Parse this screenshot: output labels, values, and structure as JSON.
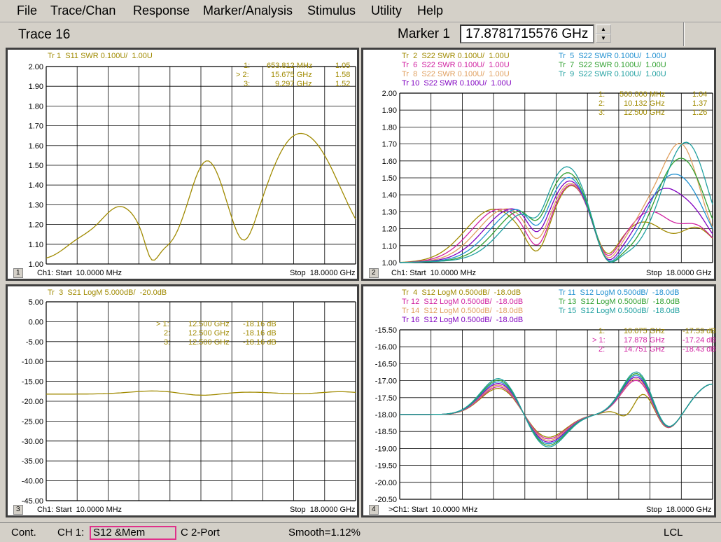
{
  "menu": [
    "File",
    "Trace/Chan",
    "Response",
    "Marker/Analysis",
    "Stimulus",
    "Utility",
    "Help"
  ],
  "header": {
    "trace_title": "Trace 16",
    "marker_label": "Marker 1",
    "marker_value": "17.8781715576 GHz"
  },
  "colors": {
    "olive": "#a08a00",
    "darkolive": "#7a6a10",
    "magenta": "#d020a0",
    "blue": "#2090d0",
    "green": "#30a030",
    "tan": "#e0a060",
    "purple": "#8000c0",
    "teal": "#20a0a0"
  },
  "panels": [
    {
      "id": 1,
      "legend": [
        {
          "text": "Tr 1  S11 SWR 0.100U/  1.00U",
          "color": "#a08a00"
        }
      ],
      "markers": [
        {
          "idx": "1:",
          "freq": "653.812 MHz",
          "val": "1.05"
        },
        {
          "idx": "> 2:",
          "freq": "15.675 GHz",
          "val": "1.58"
        },
        {
          "idx": "3:",
          "freq": "9.297 GHz",
          "val": "1.52"
        }
      ],
      "yticks": [
        "2.00",
        "1.90",
        "1.80",
        "1.70",
        "1.60",
        "1.50",
        "1.40",
        "1.30",
        "1.20",
        "1.10",
        "1.00"
      ],
      "start": "Ch1: Start  10.0000 MHz",
      "stop": "Stop  18.0000 GHz"
    },
    {
      "id": 2,
      "legend": [
        {
          "text": "Tr  2  S22 SWR 0.100U/  1.00U",
          "color": "#a08a00"
        },
        {
          "text": "Tr  6  S22 SWR 0.100U/  1.00U",
          "color": "#d020a0"
        },
        {
          "text": "Tr  8  S22 SWR 0.100U/  1.00U",
          "color": "#e0a060"
        },
        {
          "text": "Tr 10  S22 SWR 0.100U/  1.00U",
          "color": "#8000c0"
        },
        {
          "text": "Tr  5  S22 SWR 0.100U/  1.00U",
          "color": "#2090d0"
        },
        {
          "text": "Tr  7  S22 SWR 0.100U/  1.00U",
          "color": "#30a030"
        },
        {
          "text": "Tr  9  S22 SWR 0.100U/  1.00U",
          "color": "#20a0a0"
        }
      ],
      "markers": [
        {
          "idx": "1:",
          "freq": "500.000 MHz",
          "val": "1.04"
        },
        {
          "idx": "2:",
          "freq": "10.132 GHz",
          "val": "1.37"
        },
        {
          "idx": "3:",
          "freq": "12.500 GHz",
          "val": "1.26"
        }
      ],
      "yticks": [
        "2.00",
        "1.90",
        "1.80",
        "1.70",
        "1.60",
        "1.50",
        "1.40",
        "1.30",
        "1.20",
        "1.10",
        "1.00"
      ],
      "start": "Ch1: Start  10.0000 MHz",
      "stop": "Stop  18.0000 GHz"
    },
    {
      "id": 3,
      "legend": [
        {
          "text": "Tr  3  S21 LogM 5.000dB/  -20.0dB",
          "color": "#a08a00"
        }
      ],
      "markers": [
        {
          "idx": "> 1:",
          "freq": "12.500 GHz",
          "val": "-18.16 dB"
        },
        {
          "idx": "2:",
          "freq": "12.500 GHz",
          "val": "-18.16 dB"
        },
        {
          "idx": "3:",
          "freq": "12.500 GHz",
          "val": "-18.16 dB"
        }
      ],
      "yticks": [
        "5.00",
        "0.00",
        "-5.00",
        "-10.00",
        "-15.00",
        "-20.00",
        "-25.00",
        "-30.00",
        "-35.00",
        "-40.00",
        "-45.00"
      ],
      "start": "Ch1: Start  10.0000 MHz",
      "stop": "Stop  18.0000 GHz"
    },
    {
      "id": 4,
      "legend": [
        {
          "text": "Tr  4  S12 LogM 0.500dB/  -18.0dB",
          "color": "#a08a00"
        },
        {
          "text": "Tr 12  S12 LogM 0.500dB/  -18.0dB",
          "color": "#d020a0"
        },
        {
          "text": "Tr 14  S12 LogM 0.500dB/  -18.0dB",
          "color": "#e0a060"
        },
        {
          "text": "Tr 16  S12 LogM 0.500dB/  -18.0dB",
          "color": "#8000c0"
        },
        {
          "text": "Tr 11  S12 LogM 0.500dB/  -18.0dB",
          "color": "#2090d0"
        },
        {
          "text": "Tr 13  S12 LogM 0.500dB/  -18.0dB",
          "color": "#30a030"
        },
        {
          "text": "Tr 15  S12 LogM 0.500dB/  -18.0dB",
          "color": "#20a0a0"
        }
      ],
      "markers": [
        {
          "idx": "1:",
          "freq": "10.075 GHz",
          "val": "-17.59 dB"
        },
        {
          "idx": "> 1:",
          "freq": "17.878 GHz",
          "val": "-17.24 dB"
        },
        {
          "idx": "2:",
          "freq": "14.751 GHz",
          "val": "-18.43 dB"
        }
      ],
      "yticks": [
        "-15.50",
        "-16.00",
        "-16.50",
        "-17.00",
        "-17.50",
        "-18.00",
        "-18.50",
        "-19.00",
        "-19.50",
        "-20.00",
        "-20.50"
      ],
      "start": ">Ch1: Start  10.0000 MHz",
      "stop": "Stop  18.0000 GHz"
    }
  ],
  "status": {
    "mode": "Cont.",
    "ch": "CH 1:",
    "param": "S12 &Mem",
    "port": "C  2-Port",
    "smooth": "Smooth=1.12%",
    "lcl": "LCL"
  }
}
